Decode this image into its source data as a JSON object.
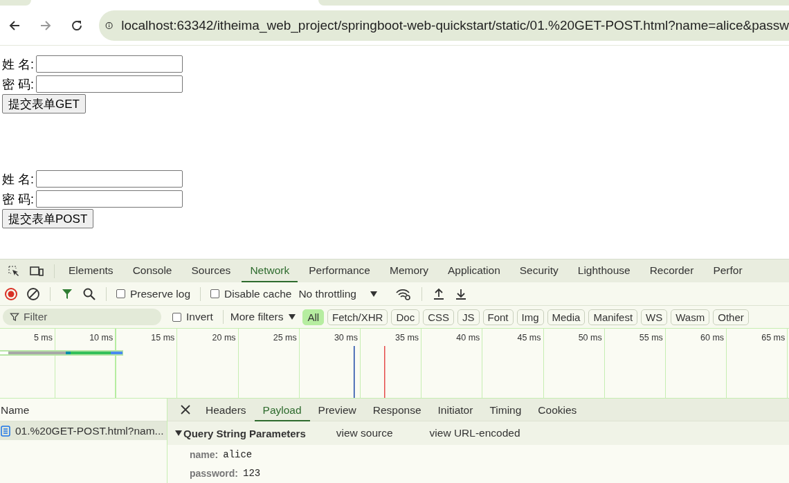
{
  "browser": {
    "address": "localhost:63342/itheima_web_project/springboot-web-quickstart/static/01.%20GET-POST.html?name=alice&passw"
  },
  "forms": [
    {
      "fields": [
        {
          "label": "姓 名:"
        },
        {
          "label": "密 码:"
        }
      ],
      "submit": "提交表单GET"
    },
    {
      "fields": [
        {
          "label": "姓 名:"
        },
        {
          "label": "密 码:"
        }
      ],
      "submit": "提交表单POST"
    }
  ],
  "devtools": {
    "tabs": [
      {
        "label": "Elements",
        "selected": false
      },
      {
        "label": "Console",
        "selected": false
      },
      {
        "label": "Sources",
        "selected": false
      },
      {
        "label": "Network",
        "selected": true
      },
      {
        "label": "Performance",
        "selected": false
      },
      {
        "label": "Memory",
        "selected": false
      },
      {
        "label": "Application",
        "selected": false
      },
      {
        "label": "Security",
        "selected": false
      },
      {
        "label": "Lighthouse",
        "selected": false
      },
      {
        "label": "Recorder",
        "selected": false
      },
      {
        "label": "Perfor",
        "selected": false
      }
    ],
    "toolbar": {
      "preserve_log": {
        "label": "Preserve log",
        "checked": false
      },
      "disable_cache": {
        "label": "Disable cache",
        "checked": false
      },
      "throttling": "No throttling"
    },
    "filter": {
      "placeholder": "Filter",
      "invert": {
        "label": "Invert",
        "checked": false
      },
      "more_filters": "More filters",
      "types": [
        {
          "label": "All",
          "selected": true
        },
        {
          "label": "Fetch/XHR",
          "selected": false
        },
        {
          "label": "Doc",
          "selected": false
        },
        {
          "label": "CSS",
          "selected": false
        },
        {
          "label": "JS",
          "selected": false
        },
        {
          "label": "Font",
          "selected": false
        },
        {
          "label": "Img",
          "selected": false
        },
        {
          "label": "Media",
          "selected": false
        },
        {
          "label": "Manifest",
          "selected": false
        },
        {
          "label": "WS",
          "selected": false
        },
        {
          "label": "Wasm",
          "selected": false
        },
        {
          "label": "Other",
          "selected": false
        }
      ]
    },
    "timeline": {
      "ticks": [
        "5 ms",
        "10 ms",
        "15 ms",
        "20 ms",
        "25 ms",
        "30 ms",
        "35 ms",
        "40 ms",
        "45 ms",
        "50 ms",
        "55 ms",
        "60 ms",
        "65 ms"
      ]
    },
    "requests": {
      "header": "Name",
      "rows": [
        {
          "name": "01.%20GET-POST.html?nam...",
          "selected": true
        }
      ]
    },
    "details": {
      "tabs": [
        {
          "label": "Headers",
          "selected": false
        },
        {
          "label": "Payload",
          "selected": true
        },
        {
          "label": "Preview",
          "selected": false
        },
        {
          "label": "Response",
          "selected": false
        },
        {
          "label": "Initiator",
          "selected": false
        },
        {
          "label": "Timing",
          "selected": false
        },
        {
          "label": "Cookies",
          "selected": false
        }
      ],
      "section": {
        "title": "Query String Parameters",
        "expanded": true,
        "links": [
          "view source",
          "view URL-encoded"
        ]
      },
      "params": [
        {
          "key": "name:",
          "value": "alice"
        },
        {
          "key": "password:",
          "value": "123"
        }
      ]
    }
  }
}
